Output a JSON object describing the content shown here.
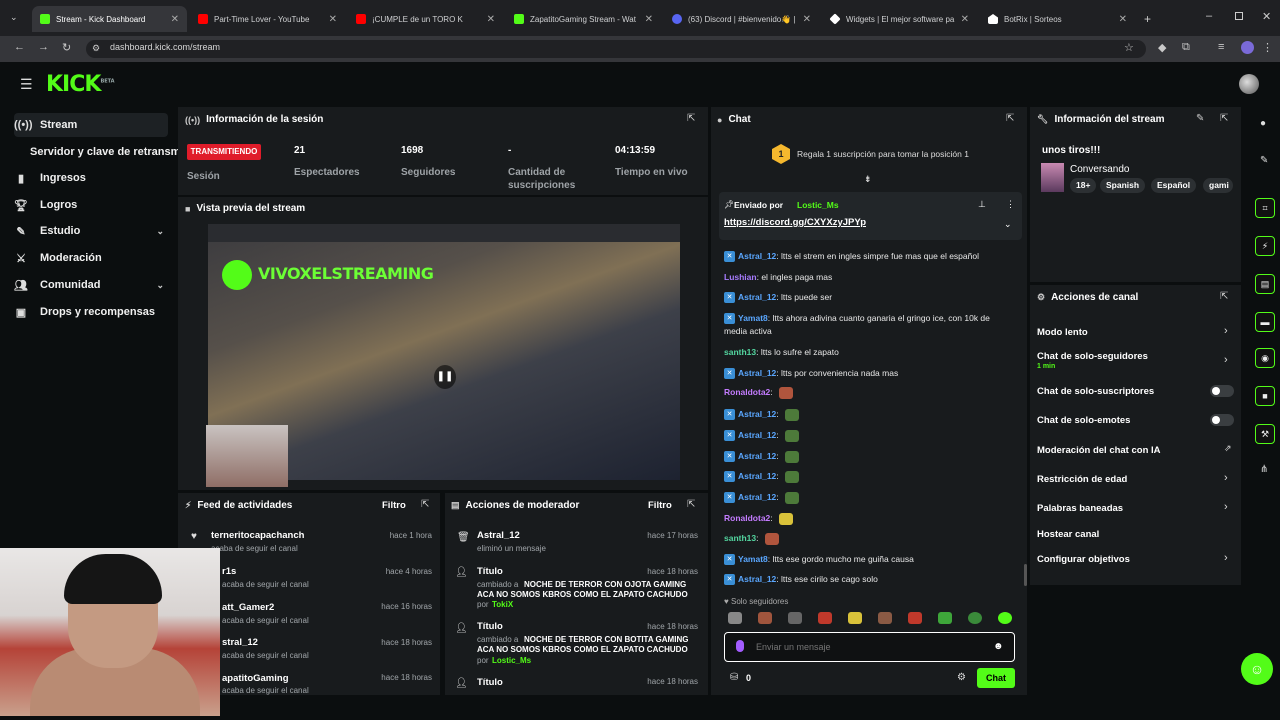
{
  "browser": {
    "tabs": [
      {
        "title": "Stream - Kick Dashboard",
        "color": "#53fc18",
        "active": true
      },
      {
        "title": "Part-Time Lover - YouTube",
        "color": "#ff0000"
      },
      {
        "title": "¡CUMPLE de un TORO K",
        "color": "#ff0000"
      },
      {
        "title": "ZapatitoGaming Stream - Wat",
        "color": "#53fc18"
      },
      {
        "title": "(63) Discord | #bienvenido👋 |",
        "color": "#5865f2"
      },
      {
        "title": "Widgets | El mejor software pa",
        "color": "#ffffff"
      },
      {
        "title": "BotRix | Sorteos",
        "color": "#ffffff"
      }
    ],
    "url": "dashboard.kick.com/stream"
  },
  "brand": {
    "logo": "KICK",
    "beta": "BETA",
    "accent": "#53fc18"
  },
  "sidebar": {
    "items": [
      {
        "label": "Stream",
        "icon": "broadcast-icon"
      },
      {
        "label": "Servidor y clave de retransmisión",
        "icon": ""
      },
      {
        "label": "Ingresos",
        "icon": "chart-icon"
      },
      {
        "label": "Logros",
        "icon": "trophy-icon"
      },
      {
        "label": "Estudio",
        "icon": "brush-icon"
      },
      {
        "label": "Moderación",
        "icon": "sword-icon"
      },
      {
        "label": "Comunidad",
        "icon": "users-icon"
      },
      {
        "label": "Drops y recompensas",
        "icon": "gift-icon"
      }
    ]
  },
  "session": {
    "title": "Información de la sesión",
    "live_badge": "TRANSMITIENDO",
    "session_label": "Sesión",
    "viewers": "21",
    "viewers_label": "Espectadores",
    "followers": "1698",
    "followers_label": "Seguidores",
    "subs": "-",
    "subs_label": "Cantidad de suscripciones",
    "uptime": "04:13:59",
    "uptime_label": "Tiempo en vivo"
  },
  "preview": {
    "title": "Vista previa del stream",
    "overlay_text": "VIVOXELSTREAMING"
  },
  "activity": {
    "title": "Feed de actividades",
    "filter": "Filtro",
    "rows": [
      {
        "name": "terneritocapachanch",
        "sub": "acaba de seguir el canal",
        "time": "hace 1 hora"
      },
      {
        "name": "r1s",
        "sub": "acaba de seguir el canal",
        "time": "hace 4 horas"
      },
      {
        "name": "att_Gamer2",
        "sub": "acaba de seguir el canal",
        "time": "hace 16 horas"
      },
      {
        "name": "stral_12",
        "sub": "acaba de seguir el canal",
        "time": "hace 18 horas"
      },
      {
        "name": "apatitoGaming",
        "sub": "acaba de seguir el canal",
        "time": "hace 18 horas"
      }
    ]
  },
  "modactions": {
    "title": "Acciones de moderador",
    "filter": "Filtro",
    "rows": [
      {
        "name": "Astral_12",
        "sub": "eliminó un mensaje",
        "time": "hace 17 horas"
      },
      {
        "name": "Título",
        "sub": "cambiado a",
        "bold": "NOCHE DE TERROR CON OJOTA GAMING ACA NO SOMOS KBROS COMO EL ZAPATO CACHUDO",
        "by": "por",
        "user": "TokiX",
        "time": "hace 18 horas"
      },
      {
        "name": "Título",
        "sub": "cambiado a",
        "bold": "NOCHE DE TERROR CON BOTITA GAMING ACA NO SOMOS KBROS COMO EL ZAPATO CACHUDO",
        "by": "por",
        "user": "Lostic_Ms",
        "time": "hace 18 horas"
      },
      {
        "name": "Título",
        "sub": "",
        "time": "hace 18 horas"
      }
    ]
  },
  "chat": {
    "title": "Chat",
    "promo": "Regala 1 suscripción para tomar la posición 1",
    "promo_rank": "1",
    "pinned_by": "Enviado por",
    "pinned_user": "Lostic_Ms",
    "pinned_link": "https://discord.gg/CXYXzyJPYp",
    "messages": [
      {
        "user": "Astral_12",
        "color": "#5aa7ff",
        "badge": true,
        "text": "ltts el strem en ingles simpre fue mas que el español"
      },
      {
        "user": "Lushian",
        "color": "#a77cff",
        "badge": false,
        "text": "el ingles paga mas"
      },
      {
        "user": "Astral_12",
        "color": "#5aa7ff",
        "badge": true,
        "text": "ltts puede ser"
      },
      {
        "user": "Yamat8",
        "color": "#5aa7ff",
        "badge": true,
        "text": "ltts ahora adivina cuanto ganaria el gringo ice, con 10k de media activa"
      },
      {
        "user": "santh13",
        "color": "#53d6a0",
        "badge": false,
        "text": "ltts lo sufre el zapato"
      },
      {
        "user": "Astral_12",
        "color": "#5aa7ff",
        "badge": true,
        "text": "ltts por conveniencia nada mas"
      },
      {
        "user": "Ronaldota2",
        "color": "#c47cff",
        "badge": false,
        "text": "",
        "emote": "#b0553d"
      },
      {
        "user": "Astral_12",
        "color": "#5aa7ff",
        "badge": true,
        "text": "",
        "emote": "#4d7a3a"
      },
      {
        "user": "Astral_12",
        "color": "#5aa7ff",
        "badge": true,
        "text": "",
        "emote": "#4d7a3a"
      },
      {
        "user": "Astral_12",
        "color": "#5aa7ff",
        "badge": true,
        "text": "",
        "emote": "#4d7a3a"
      },
      {
        "user": "Astral_12",
        "color": "#5aa7ff",
        "badge": true,
        "text": "",
        "emote": "#4d7a3a"
      },
      {
        "user": "Astral_12",
        "color": "#5aa7ff",
        "badge": true,
        "text": "",
        "emote": "#4d7a3a"
      },
      {
        "user": "Ronaldota2",
        "color": "#c47cff",
        "badge": false,
        "text": "",
        "emote": "#d9c23a"
      },
      {
        "user": "santh13",
        "color": "#53d6a0",
        "badge": false,
        "text": "",
        "emote": "#b0553d"
      },
      {
        "user": "Yamat8",
        "color": "#5aa7ff",
        "badge": true,
        "text": "ltts ese gordo mucho me guiña causa"
      },
      {
        "user": "Astral_12",
        "color": "#5aa7ff",
        "badge": true,
        "text": "ltts ese cirilo se cago solo"
      }
    ],
    "mode": "Solo seguidores",
    "placeholder": "Enviar un mensaje",
    "points": "0",
    "send": "Chat"
  },
  "streaminfo": {
    "title": "Información del stream",
    "stream_title": "unos tiros!!!",
    "category": "Conversando",
    "tags": [
      "18+",
      "Spanish",
      "Español",
      "gami"
    ]
  },
  "channelactions": {
    "title": "Acciones de canal",
    "items": [
      {
        "label": "Modo lento",
        "type": "chevron"
      },
      {
        "label": "Chat de solo-seguidores",
        "sub": "1 min",
        "type": "chevron"
      },
      {
        "label": "Chat de solo-suscriptores",
        "type": "toggle"
      },
      {
        "label": "Chat de solo-emotes",
        "type": "toggle"
      },
      {
        "label": "Moderación del chat con IA",
        "type": "external"
      },
      {
        "label": "Restricción de edad",
        "type": "chevron"
      },
      {
        "label": "Palabras baneadas",
        "type": "chevron"
      },
      {
        "label": "Hostear canal",
        "type": "none"
      },
      {
        "label": "Configurar objetivos",
        "type": "chevron"
      }
    ]
  }
}
